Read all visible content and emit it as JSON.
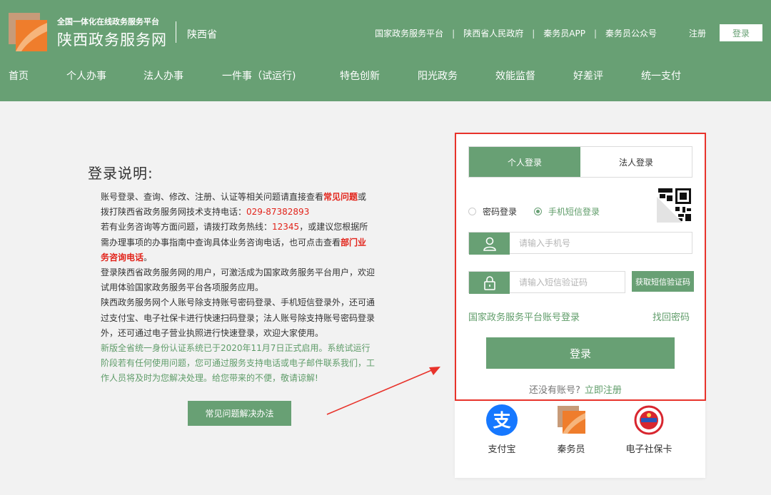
{
  "header": {
    "logo_sub": "全国一体化在线政务服务平台",
    "logo_main": "陕西政务服务网",
    "region": "陕西省",
    "links": [
      "国家政务服务平台",
      "陕西省人民政府",
      "秦务员APP",
      "秦务员公众号"
    ],
    "register": "注册",
    "login": "登录"
  },
  "nav": [
    "首页",
    "个人办事",
    "法人办事",
    "一件事（试运行)",
    "特色创新",
    "阳光政务",
    "效能监督",
    "好差评",
    "统一支付"
  ],
  "explain": {
    "title": "登录说明:",
    "p1_a": "账号登录、查询、修改、注册、认证等相关问题请直接查看",
    "p1_hl": "常见问题",
    "p1_b": "或拨打陕西省政务服务网技术支持电话：",
    "p1_phone": "029-87382893",
    "p2_a": "若有业务咨询等方面问题，请拨打政务热线：",
    "p2_phone": "12345",
    "p2_b": "，或建议您根据所需办理事项的办事指南中查询具体业务咨询电话，也可点击查看",
    "p2_hl": "部门业务咨询电话",
    "p2_c": "。",
    "p3": "登录陕西省政务服务网的用户，可激活成为国家政务服务平台用户，欢迎试用体验国家政务服务平台各项服务应用。",
    "p4": "陕西政务服务网个人账号除支持账号密码登录、手机短信登录外，还可通过支付宝、电子社保卡进行快速扫码登录；法人账号除支持账号密码登录外，还可通过电子营业执照进行快速登录，欢迎大家使用。",
    "p5": "新版全省统一身份认证系统已于2020年11月7日正式启用。系统试运行阶段若有任何使用问题，您可通过服务支持电话或电子邮件联系我们，工作人员将及时为您解决处理。给您带来的不便，敬请谅解!",
    "faq_button": "常见问题解决办法"
  },
  "login": {
    "tabs": [
      "个人登录",
      "法人登录"
    ],
    "active_tab": 0,
    "modes": [
      "密码登录",
      "手机短信登录"
    ],
    "active_mode": 1,
    "phone_placeholder": "请输入手机号",
    "code_placeholder": "请输入短信验证码",
    "sms_button": "获取短信验证码",
    "national_link": "国家政务服务平台账号登录",
    "forgot_link": "找回密码",
    "submit": "登录",
    "no_account": "还没有账号?",
    "register_now": "立即注册",
    "third_party": [
      "支付宝",
      "秦务员",
      "电子社保卡"
    ]
  },
  "colors": {
    "brand_green": "#68a074",
    "link_green": "#5f9c69",
    "highlight_red": "#e2231a",
    "frame_red": "#e8332b"
  }
}
